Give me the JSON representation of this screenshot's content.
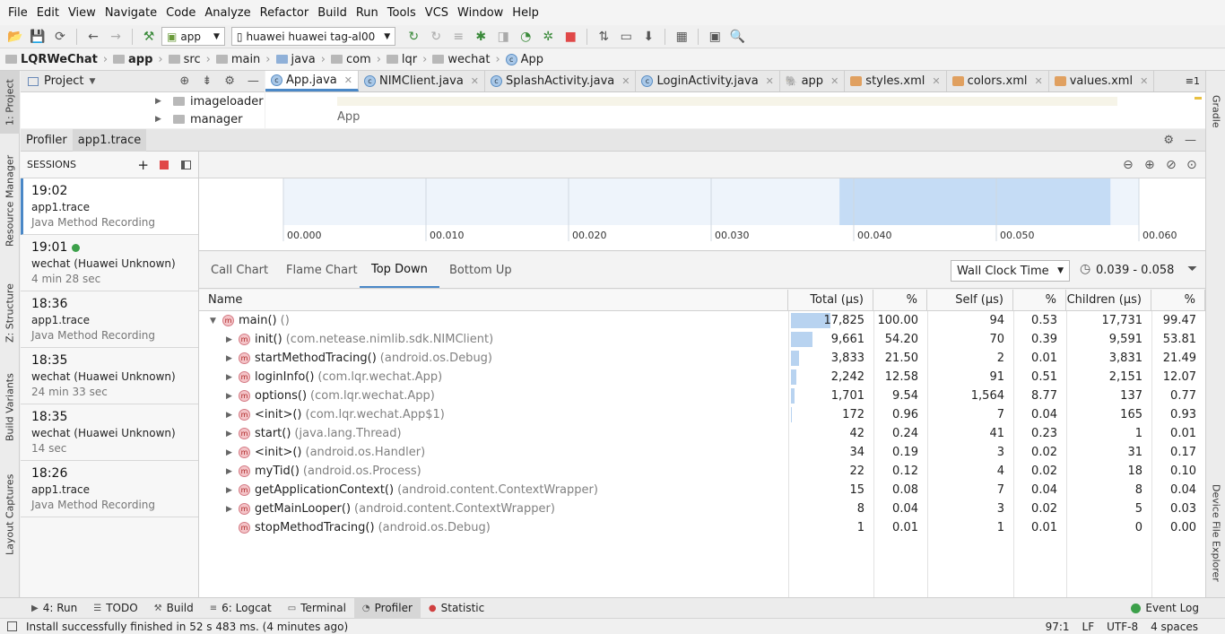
{
  "menu": [
    "File",
    "Edit",
    "View",
    "Navigate",
    "Code",
    "Analyze",
    "Refactor",
    "Build",
    "Run",
    "Tools",
    "VCS",
    "Window",
    "Help"
  ],
  "toolbar": {
    "module": "app",
    "device": "huawei huawei tag-al00"
  },
  "breadcrumb": [
    "LQRWeChat",
    "app",
    "src",
    "main",
    "java",
    "com",
    "lqr",
    "wechat",
    "App"
  ],
  "project": {
    "title": "Project",
    "tree": [
      "imageloader",
      "manager"
    ]
  },
  "editor": {
    "tabs": [
      "App.java",
      "NIMClient.java",
      "SplashActivity.java",
      "LoginActivity.java",
      "app",
      "styles.xml",
      "colors.xml",
      "values.xml"
    ],
    "tabs_overflow": "≡1",
    "breadcrumb": "App"
  },
  "profiler": {
    "tabs": [
      "Profiler",
      "app1.trace"
    ]
  },
  "sessions": {
    "title": "SESSIONS",
    "items": [
      {
        "time": "19:02",
        "name": "app1.trace",
        "sub": "Java Method Recording",
        "live": false
      },
      {
        "time": "19:01",
        "name": "wechat (Huawei Unknown)",
        "sub": "4 min 28 sec",
        "live": true
      },
      {
        "time": "18:36",
        "name": "app1.trace",
        "sub": "Java Method Recording",
        "live": false
      },
      {
        "time": "18:35",
        "name": "wechat (Huawei Unknown)",
        "sub": "24 min 33 sec",
        "live": false
      },
      {
        "time": "18:35",
        "name": "wechat (Huawei Unknown)",
        "sub": "14 sec",
        "live": false
      },
      {
        "time": "18:26",
        "name": "app1.trace",
        "sub": "Java Method Recording",
        "live": false
      }
    ]
  },
  "timeline": {
    "ticks": [
      "00.000",
      "00.010",
      "00.020",
      "00.030",
      "00.040",
      "00.050",
      "00.060"
    ],
    "selection": [
      0.039,
      0.058
    ],
    "range": [
      0.0,
      0.06
    ]
  },
  "analysis": {
    "tabs": [
      "Call Chart",
      "Flame Chart",
      "Top Down",
      "Bottom Up"
    ],
    "active": 2,
    "clock": "Wall Clock Time",
    "range": "0.039 - 0.058"
  },
  "table": {
    "headers": [
      "Name",
      "Total (μs)",
      "%",
      "Self (μs)",
      "%",
      "Children (μs)",
      "%"
    ],
    "rows": [
      {
        "method": "main()",
        "cls": "()",
        "total": "17,825",
        "tp": "100.00",
        "self": "94",
        "sp": "0.53",
        "child": "17,731",
        "cp": "99.47",
        "bar": 1.0,
        "level": 0,
        "expand": "open"
      },
      {
        "method": "init()",
        "cls": "(com.netease.nimlib.sdk.NIMClient)",
        "total": "9,661",
        "tp": "54.20",
        "self": "70",
        "sp": "0.39",
        "child": "9,591",
        "cp": "53.81",
        "bar": 0.542,
        "level": 1,
        "expand": "closed"
      },
      {
        "method": "startMethodTracing()",
        "cls": "(android.os.Debug)",
        "total": "3,833",
        "tp": "21.50",
        "self": "2",
        "sp": "0.01",
        "child": "3,831",
        "cp": "21.49",
        "bar": 0.215,
        "level": 1,
        "expand": "closed"
      },
      {
        "method": "loginInfo()",
        "cls": "(com.lqr.wechat.App)",
        "total": "2,242",
        "tp": "12.58",
        "self": "91",
        "sp": "0.51",
        "child": "2,151",
        "cp": "12.07",
        "bar": 0.126,
        "level": 1,
        "expand": "closed"
      },
      {
        "method": "options()",
        "cls": "(com.lqr.wechat.App)",
        "total": "1,701",
        "tp": "9.54",
        "self": "1,564",
        "sp": "8.77",
        "child": "137",
        "cp": "0.77",
        "bar": 0.095,
        "level": 1,
        "expand": "closed"
      },
      {
        "method": "<init>()",
        "cls": "(com.lqr.wechat.App$1)",
        "total": "172",
        "tp": "0.96",
        "self": "7",
        "sp": "0.04",
        "child": "165",
        "cp": "0.93",
        "bar": 0.0096,
        "level": 1,
        "expand": "closed"
      },
      {
        "method": "start()",
        "cls": "(java.lang.Thread)",
        "total": "42",
        "tp": "0.24",
        "self": "41",
        "sp": "0.23",
        "child": "1",
        "cp": "0.01",
        "bar": 0.0024,
        "level": 1,
        "expand": "closed"
      },
      {
        "method": "<init>()",
        "cls": "(android.os.Handler)",
        "total": "34",
        "tp": "0.19",
        "self": "3",
        "sp": "0.02",
        "child": "31",
        "cp": "0.17",
        "bar": 0.0019,
        "level": 1,
        "expand": "closed"
      },
      {
        "method": "myTid()",
        "cls": "(android.os.Process)",
        "total": "22",
        "tp": "0.12",
        "self": "4",
        "sp": "0.02",
        "child": "18",
        "cp": "0.10",
        "bar": 0.0012,
        "level": 1,
        "expand": "closed"
      },
      {
        "method": "getApplicationContext()",
        "cls": "(android.content.ContextWrapper)",
        "total": "15",
        "tp": "0.08",
        "self": "7",
        "sp": "0.04",
        "child": "8",
        "cp": "0.04",
        "bar": 0.0008,
        "level": 1,
        "expand": "closed"
      },
      {
        "method": "getMainLooper()",
        "cls": "(android.content.ContextWrapper)",
        "total": "8",
        "tp": "0.04",
        "self": "3",
        "sp": "0.02",
        "child": "5",
        "cp": "0.03",
        "bar": 0.0004,
        "level": 1,
        "expand": "closed"
      },
      {
        "method": "stopMethodTracing()",
        "cls": "(android.os.Debug)",
        "total": "1",
        "tp": "0.01",
        "self": "1",
        "sp": "0.01",
        "child": "0",
        "cp": "0.00",
        "bar": 6e-05,
        "level": 1,
        "expand": "none"
      }
    ]
  },
  "left_tabs": [
    "1: Project",
    "Resource Manager",
    "Z: Structure",
    "Build Variants",
    "Layout Captures"
  ],
  "right_tabs": [
    "Gradle",
    "Device File Explorer"
  ],
  "bottom_tabs": [
    "4: Run",
    "TODO",
    "Build",
    "6: Logcat",
    "Terminal",
    "Profiler",
    "Statistic"
  ],
  "event_log": "Event Log",
  "status": {
    "message": "Install successfully finished in 52 s 483 ms. (4 minutes ago)",
    "pos": "97:1",
    "lf": "LF",
    "enc": "UTF-8",
    "indent": "4 spaces"
  },
  "colors": {
    "accent": "#4a88c7",
    "selection": "#c5dcf5",
    "bar": "#b8d3f0",
    "live": "#3ca04a",
    "record": "#e04848"
  }
}
